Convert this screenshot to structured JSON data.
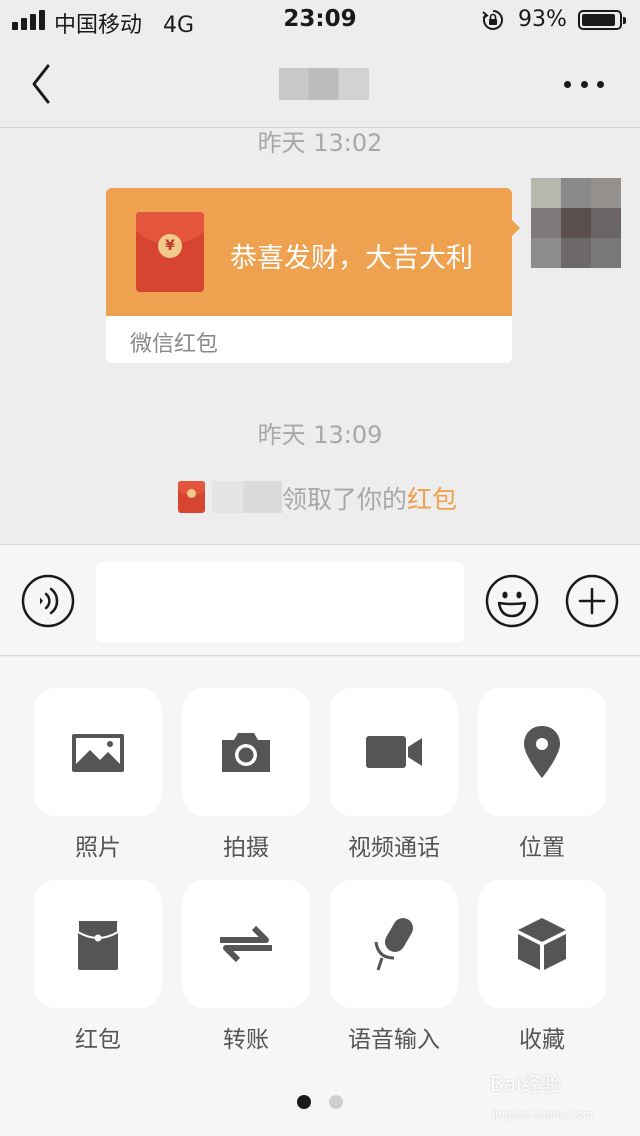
{
  "status_bar": {
    "carrier": "中国移动",
    "network": "4G",
    "time": "23:09",
    "battery": "93%",
    "battery_level": 0.93
  },
  "nav": {
    "back_icon": "chevron-left-icon",
    "more_icon": "ellipsis-icon"
  },
  "chat": {
    "timestamp_1": "昨天 13:02",
    "red_packet": {
      "greeting": "恭喜发财，大吉大利",
      "footer": "微信红包",
      "coin_symbol": "¥",
      "color": "#eea14f"
    },
    "timestamp_2": "昨天 13:09",
    "notice": {
      "text": "领取了你的",
      "link": "红包",
      "link_color": "#f0a048"
    }
  },
  "input_bar": {
    "voice_icon": "voice-icon",
    "emoji_icon": "emoji-icon",
    "plus_icon": "plus-icon",
    "value": ""
  },
  "panel": {
    "tools": [
      {
        "label": "照片",
        "icon": "photo-icon"
      },
      {
        "label": "拍摄",
        "icon": "camera-icon"
      },
      {
        "label": "视频通话",
        "icon": "video-call-icon"
      },
      {
        "label": "位置",
        "icon": "location-icon"
      },
      {
        "label": "红包",
        "icon": "red-packet-icon"
      },
      {
        "label": "转账",
        "icon": "transfer-icon"
      },
      {
        "label": "语音输入",
        "icon": "microphone-icon"
      },
      {
        "label": "收藏",
        "icon": "favorites-icon"
      }
    ],
    "page": 1,
    "page_count": 2
  },
  "watermark": {
    "brand": "Bai经验",
    "url": "jingyan.baidu.com"
  }
}
